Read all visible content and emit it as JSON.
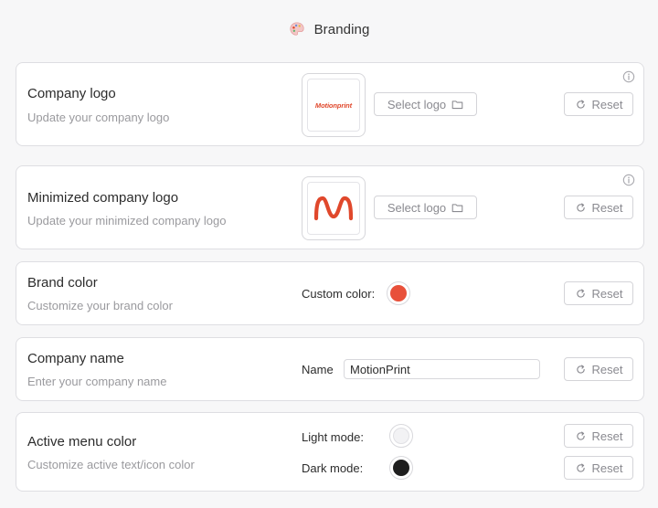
{
  "header": {
    "title": "Branding",
    "icon": "palette-icon"
  },
  "colors": {
    "brand": "#E8503A",
    "light_mode": "#F2F2F4",
    "dark_mode": "#1E1E1E"
  },
  "company_logo": {
    "label": "Company logo",
    "description": "Update your company logo",
    "logo_text": "Motionprint",
    "select_label": "Select logo",
    "reset_label": "Reset"
  },
  "minimized_logo": {
    "label": "Minimized company logo",
    "description": "Update your minimized company logo",
    "select_label": "Select logo",
    "reset_label": "Reset"
  },
  "brand_color": {
    "label": "Brand color",
    "description": "Customize your brand color",
    "custom_label": "Custom color:",
    "reset_label": "Reset"
  },
  "company_name": {
    "label": "Company name",
    "description": "Enter your company name",
    "field_label": "Name",
    "value": "MotionPrint",
    "reset_label": "Reset"
  },
  "active_menu_color": {
    "label": "Active menu color",
    "description": "Customize active text/icon color",
    "light_label": "Light mode:",
    "dark_label": "Dark mode:",
    "reset_label": "Reset"
  }
}
